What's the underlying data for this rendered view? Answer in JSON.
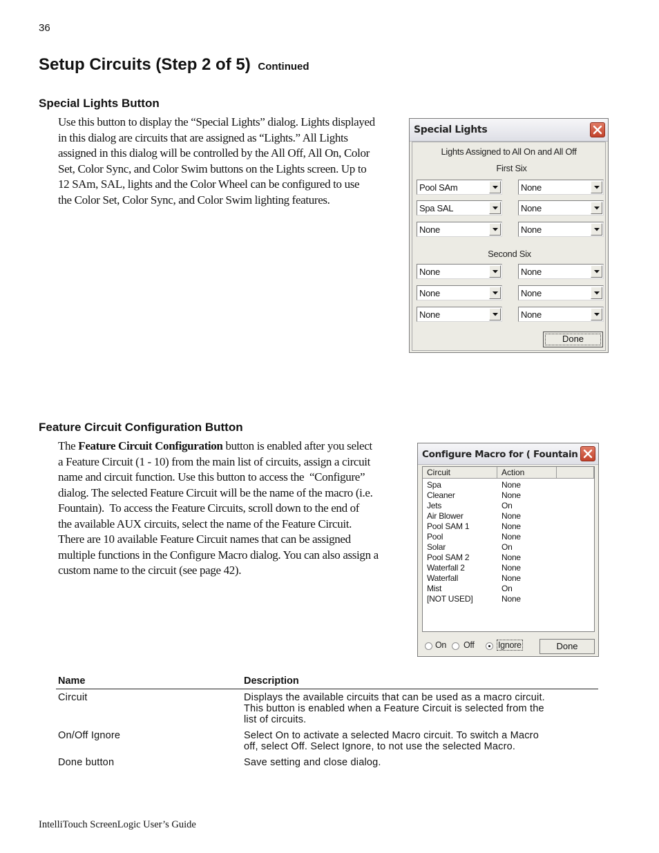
{
  "page": {
    "number": "36",
    "title": "Setup Circuits (Step 2 of 5)",
    "title_suffix": "Continued",
    "footer": "IntelliTouch ScreenLogic User’s Guide"
  },
  "special_lights": {
    "heading": "Special Lights Button",
    "paragraph_lines": [
      "Use this button to display the “Special Lights” dialog. Lights displayed",
      "in this dialog are circuits that are assigned as “Lights.” All Lights",
      "assigned in this dialog will be controlled by the All Off, All On, Color",
      "Set, Color Sync, and Color Swim buttons on the Lights screen. Up to",
      "12 SAm, SAL, lights and the Color Wheel can be configured to use",
      "the Color Set, Color Sync, and Color Swim lighting features."
    ],
    "dialog": {
      "title": "Special Lights",
      "caption": "Lights Assigned to All On and All Off",
      "first_six_label": "First Six",
      "second_six_label": "Second Six",
      "first_six": [
        "Pool SAm",
        "None",
        "Spa SAL",
        "None",
        "None",
        "None"
      ],
      "second_six": [
        "None",
        "None",
        "None",
        "None",
        "None",
        "None"
      ],
      "done_label": "Done"
    }
  },
  "feature_circuit": {
    "heading": "Feature Circuit Configuration Button",
    "para_first_prefix": "The ",
    "para_first_bold": "Feature Circuit Configuration",
    "para_first_suffix": " button is enabled after you select",
    "paragraph_lines": [
      "a Feature Circuit (1 - 10) from the main list of circuits, assign a circuit",
      "name and circuit function. Use this button to access the  “Configure”",
      "dialog. The selected Feature Circuit will be the name of the macro (i.e.",
      "Fountain).  To access the Feature Circuits, scroll down to the end of",
      "the available AUX circuits, select the name of the Feature Circuit.",
      "There are 10 available Feature Circuit names that can be assigned",
      "multiple functions in the Configure Macro dialog. You can also assign a",
      "custom name to the circuit (see page 42)."
    ],
    "dialog": {
      "title": "Configure Macro for ( Fountain )",
      "columns": [
        "Circuit",
        "Action",
        ""
      ],
      "rows": [
        {
          "circuit": "Spa",
          "action": "None"
        },
        {
          "circuit": "Cleaner",
          "action": "None"
        },
        {
          "circuit": "Jets",
          "action": "On"
        },
        {
          "circuit": "Air Blower",
          "action": "None"
        },
        {
          "circuit": "Pool SAM 1",
          "action": "None"
        },
        {
          "circuit": "Pool",
          "action": "None"
        },
        {
          "circuit": "Solar",
          "action": "On"
        },
        {
          "circuit": "Pool SAM 2",
          "action": "None"
        },
        {
          "circuit": "Waterfall 2",
          "action": "None"
        },
        {
          "circuit": "Waterfall",
          "action": "None"
        },
        {
          "circuit": "Mist",
          "action": "On"
        },
        {
          "circuit": "[NOT USED]",
          "action": "None"
        }
      ],
      "radio_options": [
        "On",
        "Off",
        "Ignore"
      ],
      "radio_selected": "Ignore",
      "done_label": "Done"
    }
  },
  "table": {
    "headers": [
      "Name",
      "Description"
    ],
    "rows": [
      {
        "name": "Circuit",
        "desc_lines": [
          "Displays the available circuits that can be used as a macro circuit.",
          "This button is enabled when a Feature Circuit is selected from the",
          "list of circuits."
        ]
      },
      {
        "name": "On/Off Ignore",
        "desc_lines": [
          "Select On to activate a selected Macro circuit. To switch a Macro",
          "off, select Off. Select Ignore, to not use the selected Macro."
        ]
      },
      {
        "name": "Done button",
        "desc_lines": [
          "Save setting and close dialog."
        ]
      }
    ]
  }
}
